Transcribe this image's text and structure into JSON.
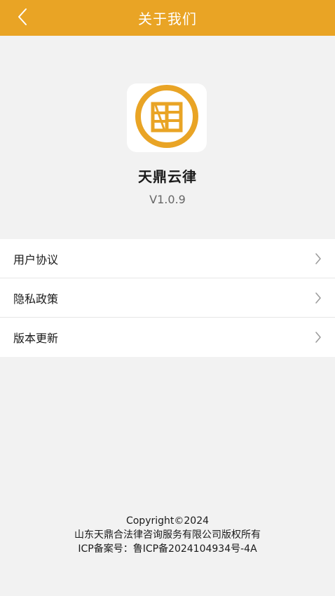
{
  "theme": {
    "accent": "#e9a425",
    "background": "#f2f2f2"
  },
  "header": {
    "title": "关于我们",
    "back_icon": "chevron-left-icon"
  },
  "app": {
    "logo_icon": "app-logo-icon",
    "name": "天鼎云律",
    "version": "V1.0.9"
  },
  "menu": {
    "items": [
      {
        "label": "用户协议",
        "icon": "chevron-right-icon"
      },
      {
        "label": "隐私政策",
        "icon": "chevron-right-icon"
      },
      {
        "label": "版本更新",
        "icon": "chevron-right-icon"
      }
    ]
  },
  "footer": {
    "copyright": "Copyright©2024",
    "company": "山东天鼎合法律咨询服务有限公司版权所有",
    "icp": "ICP备案号：鲁ICP备2024104934号-4A"
  }
}
